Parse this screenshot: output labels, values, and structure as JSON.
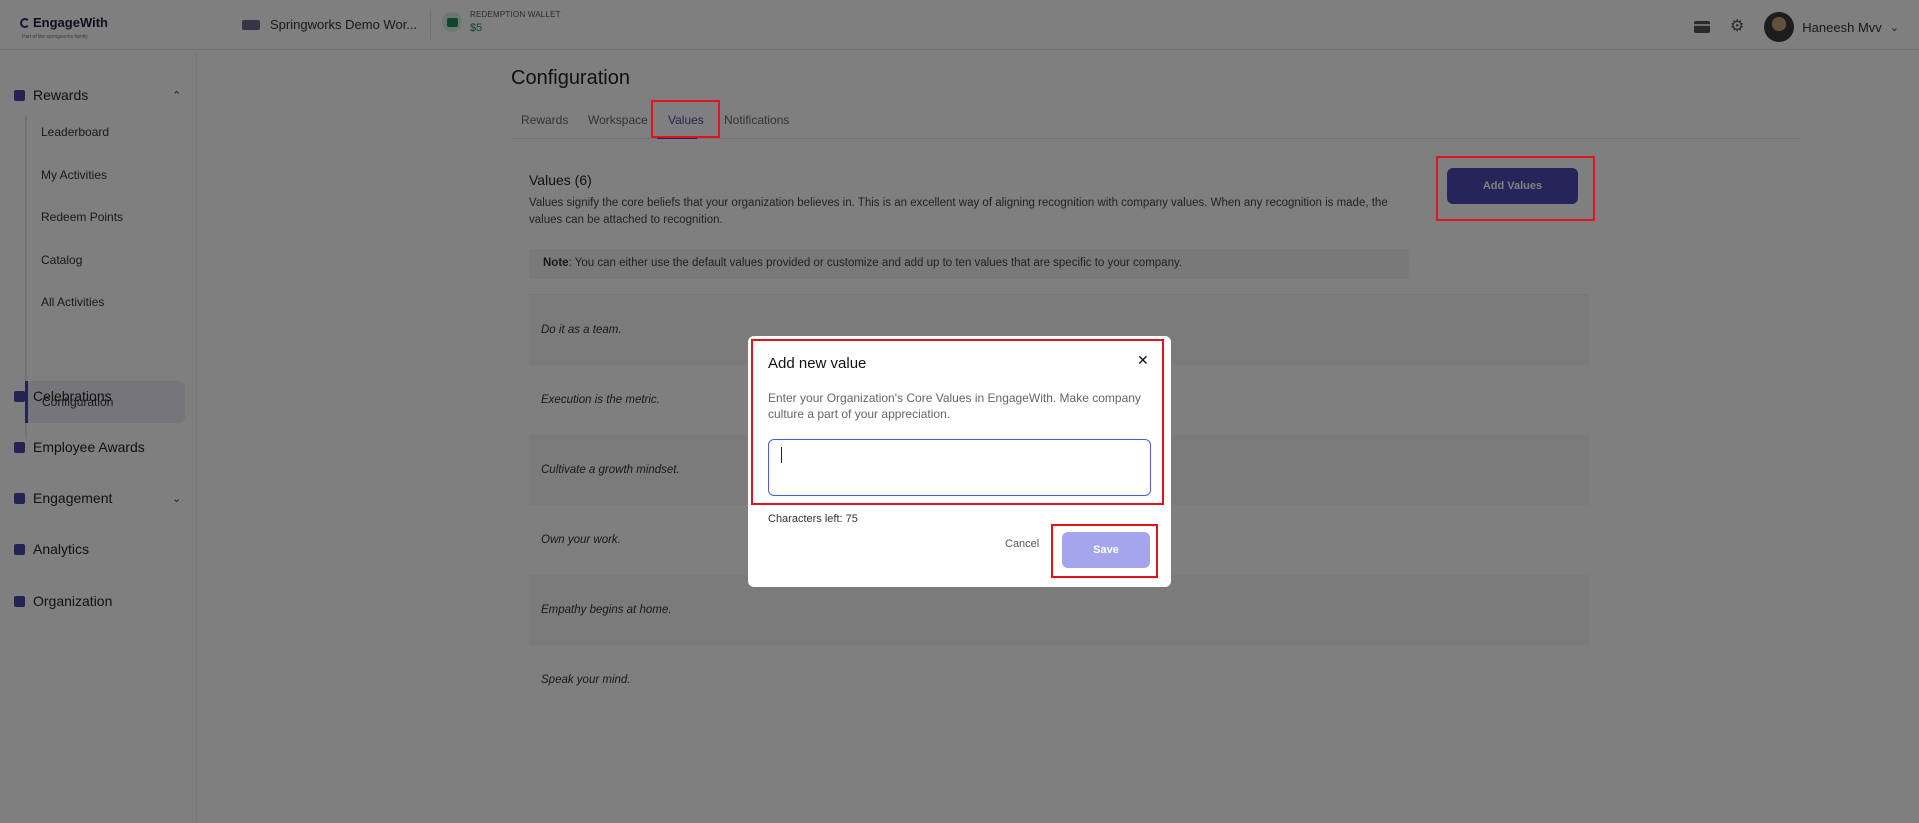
{
  "header": {
    "logo_text": "EngageWith",
    "logo_subtext": "Part of the springworks family",
    "workspace_name": "Springworks Demo Wor...",
    "wallet_label": "REDEMPTION WALLET",
    "wallet_amount": "$5",
    "user_name": "Haneesh Mvv"
  },
  "sidebar": {
    "rewards": "Rewards",
    "sub_items": [
      "Leaderboard",
      "My Activities",
      "Redeem Points",
      "Catalog",
      "All Activities",
      "Configuration"
    ],
    "items": [
      "Celebrations",
      "Employee Awards",
      "Engagement",
      "Analytics",
      "Organization"
    ]
  },
  "main": {
    "title": "Configuration",
    "tabs": [
      "Rewards",
      "Workspace",
      "Values",
      "Notifications"
    ],
    "active_tab": "Values",
    "values_title": "Values (6)",
    "values_desc": "Values signify the core beliefs that your organization believes in. This is an excellent way of aligning recognition with company values. When any recognition is made, the values can be attached to recognition.",
    "add_button": "Add Values",
    "note_label": "Note",
    "note_text": ": You can either use the default values provided or customize and add up to ten values that are specific to your company.",
    "values": [
      "Do it as a team.",
      "Execution is the metric.",
      "Cultivate a growth mindset.",
      "Own your work.",
      "Empathy begins at home.",
      "Speak your mind."
    ]
  },
  "modal": {
    "title": "Add new value",
    "description": "Enter your Organization's Core Values in EngageWith. Make company culture a part of your appreciation.",
    "input_value": "",
    "chars_left": "Characters left: 75",
    "cancel": "Cancel",
    "save": "Save"
  },
  "colors": {
    "accent": "#4848a8",
    "highlight": "#e0141e",
    "save_disabled": "#a5a5ee"
  }
}
